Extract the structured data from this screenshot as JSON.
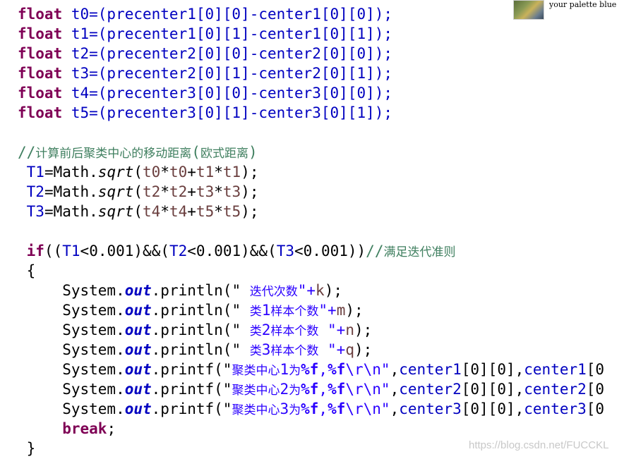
{
  "code_lines": [
    [
      {
        "t": "float",
        "c": "kw"
      },
      {
        "t": " t0=(precenter1[0][0]-center1[0][0]);",
        "c": "fld"
      }
    ],
    [
      {
        "t": "float",
        "c": "kw"
      },
      {
        "t": " t1=(precenter1[0][1]-center1[0][1]);",
        "c": "fld"
      }
    ],
    [
      {
        "t": "float",
        "c": "kw"
      },
      {
        "t": " t2=(precenter2[0][0]-center2[0][0]);",
        "c": "fld"
      }
    ],
    [
      {
        "t": "float",
        "c": "kw"
      },
      {
        "t": " t3=(precenter2[0][1]-center2[0][1]);",
        "c": "fld"
      }
    ],
    [
      {
        "t": "float",
        "c": "kw"
      },
      {
        "t": " t4=(precenter3[0][0]-center3[0][0]);",
        "c": "fld"
      }
    ],
    [
      {
        "t": "float",
        "c": "kw"
      },
      {
        "t": " t5=(precenter3[0][1]-center3[0][1]);",
        "c": "fld"
      }
    ],
    [],
    [
      {
        "t": "//",
        "c": "cmt"
      },
      {
        "t": "计算前后聚类中心的移动距离",
        "c": "cmt cjk"
      },
      {
        "t": "(",
        "c": "cmt"
      },
      {
        "t": "欧式距离",
        "c": "cmt cjk"
      },
      {
        "t": ")",
        "c": "cmt"
      }
    ],
    [
      {
        "t": " T1",
        "c": "fld"
      },
      {
        "t": "=Math.",
        "c": ""
      },
      {
        "t": "sqrt",
        "c": "ital"
      },
      {
        "t": "(",
        "c": ""
      },
      {
        "t": "t0",
        "c": "lv"
      },
      {
        "t": "*",
        "c": ""
      },
      {
        "t": "t0",
        "c": "lv"
      },
      {
        "t": "+",
        "c": ""
      },
      {
        "t": "t1",
        "c": "lv"
      },
      {
        "t": "*",
        "c": ""
      },
      {
        "t": "t1",
        "c": "lv"
      },
      {
        "t": ");",
        "c": ""
      }
    ],
    [
      {
        "t": " T2",
        "c": "fld"
      },
      {
        "t": "=Math.",
        "c": ""
      },
      {
        "t": "sqrt",
        "c": "ital"
      },
      {
        "t": "(",
        "c": ""
      },
      {
        "t": "t2",
        "c": "lv"
      },
      {
        "t": "*",
        "c": ""
      },
      {
        "t": "t2",
        "c": "lv"
      },
      {
        "t": "+",
        "c": ""
      },
      {
        "t": "t3",
        "c": "lv"
      },
      {
        "t": "*",
        "c": ""
      },
      {
        "t": "t3",
        "c": "lv"
      },
      {
        "t": ");",
        "c": ""
      }
    ],
    [
      {
        "t": " T3",
        "c": "fld"
      },
      {
        "t": "=Math.",
        "c": ""
      },
      {
        "t": "sqrt",
        "c": "ital"
      },
      {
        "t": "(",
        "c": ""
      },
      {
        "t": "t4",
        "c": "lv"
      },
      {
        "t": "*",
        "c": ""
      },
      {
        "t": "t4",
        "c": "lv"
      },
      {
        "t": "+",
        "c": ""
      },
      {
        "t": "t5",
        "c": "lv"
      },
      {
        "t": "*",
        "c": ""
      },
      {
        "t": "t5",
        "c": "lv"
      },
      {
        "t": ");",
        "c": ""
      }
    ],
    [],
    [
      {
        "t": " ",
        "c": ""
      },
      {
        "t": "if",
        "c": "kw"
      },
      {
        "t": "((",
        "c": ""
      },
      {
        "t": "T1",
        "c": "fld"
      },
      {
        "t": "<0.001)&&(",
        "c": ""
      },
      {
        "t": "T2",
        "c": "fld"
      },
      {
        "t": "<0.001)&&(",
        "c": ""
      },
      {
        "t": "T3",
        "c": "fld"
      },
      {
        "t": "<0.001))",
        "c": ""
      },
      {
        "t": "//",
        "c": "cmt"
      },
      {
        "t": "满足迭代准则",
        "c": "cmt cjk"
      }
    ],
    [
      {
        "t": " {",
        "c": ""
      }
    ],
    [
      {
        "t": "     System.",
        "c": ""
      },
      {
        "t": "out",
        "c": "staticfld"
      },
      {
        "t": ".println(\" ",
        "c": ""
      },
      {
        "t": "迭代次数",
        "c": "str cjk"
      },
      {
        "t": "\"+",
        "c": "str"
      },
      {
        "t": "k",
        "c": "lv"
      },
      {
        "t": ");",
        "c": ""
      }
    ],
    [
      {
        "t": "     System.",
        "c": ""
      },
      {
        "t": "out",
        "c": "staticfld"
      },
      {
        "t": ".println(\" ",
        "c": ""
      },
      {
        "t": "类",
        "c": "str cjk"
      },
      {
        "t": "1",
        "c": "str"
      },
      {
        "t": "样本个数",
        "c": "str cjk"
      },
      {
        "t": "\"+",
        "c": "str"
      },
      {
        "t": "m",
        "c": "lv"
      },
      {
        "t": ");",
        "c": ""
      }
    ],
    [
      {
        "t": "     System.",
        "c": ""
      },
      {
        "t": "out",
        "c": "staticfld"
      },
      {
        "t": ".println(\" ",
        "c": ""
      },
      {
        "t": "类",
        "c": "str cjk"
      },
      {
        "t": "2",
        "c": "str"
      },
      {
        "t": "样本个数",
        "c": "str cjk"
      },
      {
        "t": " \"+",
        "c": "str"
      },
      {
        "t": "n",
        "c": "lv"
      },
      {
        "t": ");",
        "c": ""
      }
    ],
    [
      {
        "t": "     System.",
        "c": ""
      },
      {
        "t": "out",
        "c": "staticfld"
      },
      {
        "t": ".println(\" ",
        "c": ""
      },
      {
        "t": "类",
        "c": "str cjk"
      },
      {
        "t": "3",
        "c": "str"
      },
      {
        "t": "样本个数",
        "c": "str cjk"
      },
      {
        "t": " \"+",
        "c": "str"
      },
      {
        "t": "q",
        "c": "lv"
      },
      {
        "t": ");",
        "c": ""
      }
    ],
    [
      {
        "t": "     System.",
        "c": ""
      },
      {
        "t": "out",
        "c": "staticfld"
      },
      {
        "t": ".printf(\"",
        "c": ""
      },
      {
        "t": "聚类中心",
        "c": "str cjk"
      },
      {
        "t": "1",
        "c": "str"
      },
      {
        "t": "为",
        "c": "str cjk"
      },
      {
        "t": "%f",
        "c": "fmt"
      },
      {
        "t": ",",
        "c": "str"
      },
      {
        "t": "%f",
        "c": "fmt"
      },
      {
        "t": "\\r\\n\"",
        "c": "str"
      },
      {
        "t": ",",
        "c": ""
      },
      {
        "t": "center1",
        "c": "fld"
      },
      {
        "t": "[0][0],",
        "c": ""
      },
      {
        "t": "center1",
        "c": "fld"
      },
      {
        "t": "[0",
        "c": ""
      }
    ],
    [
      {
        "t": "     System.",
        "c": ""
      },
      {
        "t": "out",
        "c": "staticfld"
      },
      {
        "t": ".printf(\"",
        "c": ""
      },
      {
        "t": "聚类中心",
        "c": "str cjk"
      },
      {
        "t": "2",
        "c": "str"
      },
      {
        "t": "为",
        "c": "str cjk"
      },
      {
        "t": "%f",
        "c": "fmt"
      },
      {
        "t": ",",
        "c": "str"
      },
      {
        "t": "%f",
        "c": "fmt"
      },
      {
        "t": "\\r\\n\"",
        "c": "str"
      },
      {
        "t": ",",
        "c": ""
      },
      {
        "t": "center2",
        "c": "fld"
      },
      {
        "t": "[0][0],",
        "c": ""
      },
      {
        "t": "center2",
        "c": "fld"
      },
      {
        "t": "[0",
        "c": ""
      }
    ],
    [
      {
        "t": "     System.",
        "c": ""
      },
      {
        "t": "out",
        "c": "staticfld"
      },
      {
        "t": ".printf(\"",
        "c": ""
      },
      {
        "t": "聚类中心",
        "c": "str cjk"
      },
      {
        "t": "3",
        "c": "str"
      },
      {
        "t": "为",
        "c": "str cjk"
      },
      {
        "t": "%f",
        "c": "fmt"
      },
      {
        "t": ",",
        "c": "str"
      },
      {
        "t": "%f",
        "c": "fmt"
      },
      {
        "t": "\\r\\n\"",
        "c": "str"
      },
      {
        "t": ",",
        "c": ""
      },
      {
        "t": "center3",
        "c": "fld"
      },
      {
        "t": "[0][0],",
        "c": ""
      },
      {
        "t": "center3",
        "c": "fld"
      },
      {
        "t": "[0",
        "c": ""
      }
    ],
    [
      {
        "t": "     ",
        "c": ""
      },
      {
        "t": "break",
        "c": "kw"
      },
      {
        "t": ";",
        "c": ""
      }
    ],
    [
      {
        "t": " }",
        "c": ""
      }
    ]
  ],
  "overlay": {
    "palette_label": "your palette blue",
    "watermark": "https://blog.csdn.net/FUCCKL"
  },
  "colors": {
    "keyword": "#7f0055",
    "field": "#0000c0",
    "local_variable": "#6a3e3e",
    "string": "#2a00ff",
    "comment": "#3f7f5f",
    "watermark": "#c8c8c8"
  }
}
